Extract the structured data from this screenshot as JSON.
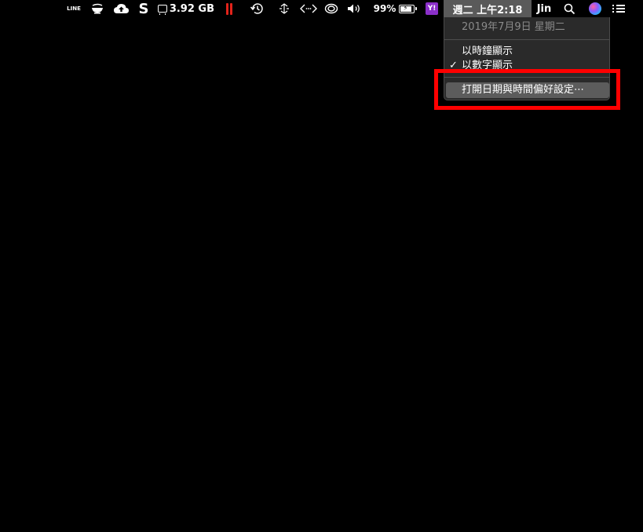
{
  "menubar": {
    "line_label": "LINE",
    "memory_value": "3.92 GB",
    "battery_percent": "99%",
    "battery_level": 0.99,
    "yahoo_label": "Y!",
    "clock_label": "週二 上午2:18",
    "user_name": "Jin",
    "icons": {
      "line": "line-icon",
      "coffee": "coffee-cup-icon",
      "cloud": "cloud-upload-icon",
      "s_app": "s-app-icon",
      "memory": "memory-chip-icon",
      "pause": "pause-icon",
      "time_machine": "time-machine-icon",
      "sync": "sync-arrows-icon",
      "code": "code-brackets-icon",
      "airplay": "airplay-swirl-icon",
      "volume": "volume-icon",
      "battery": "battery-charging-icon",
      "yahoo": "yahoo-icon",
      "search": "search-icon",
      "siri": "siri-icon",
      "notification": "notification-center-icon"
    },
    "colors": {
      "pause": "#e2231a",
      "yahoo": "#8b2fc9",
      "active_item": "#5a5a5a"
    }
  },
  "clock_menu": {
    "date_label": "2019年7月9日 星期二",
    "items": [
      {
        "label": "以時鐘顯示",
        "checked": false
      },
      {
        "label": "以數字顯示",
        "checked": true
      }
    ],
    "checkmark": "✓",
    "open_prefs_label": "打開日期與時間偏好設定⋯"
  },
  "annotation": {
    "color": "#ff0000"
  }
}
